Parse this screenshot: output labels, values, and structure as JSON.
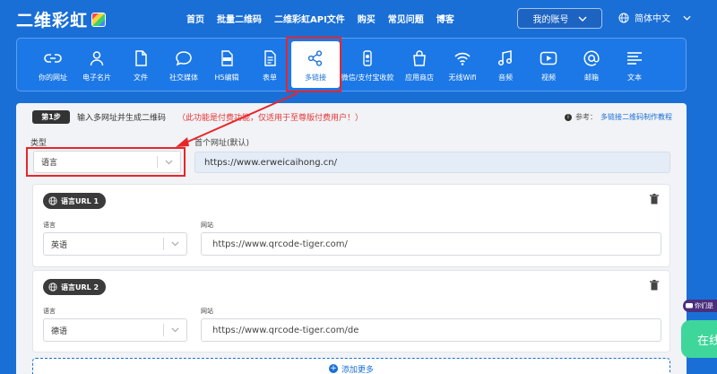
{
  "header": {
    "logo": "二维彩虹",
    "nav": [
      "首页",
      "批量二维码",
      "二维彩虹API文件",
      "购买",
      "常见问题",
      "博客"
    ],
    "account": "我的账号",
    "language": "简体中文"
  },
  "toolbar": {
    "items": [
      {
        "label": "你的网址",
        "icon": "link-icon"
      },
      {
        "label": "电子名片",
        "icon": "person-icon"
      },
      {
        "label": "文件",
        "icon": "file-icon"
      },
      {
        "label": "社交媒体",
        "icon": "chat-bubble-icon"
      },
      {
        "label": "H5编辑",
        "icon": "html-file-icon"
      },
      {
        "label": "表单",
        "icon": "form-icon"
      },
      {
        "label": "多链接",
        "icon": "share-icon"
      },
      {
        "label": "微信/支付宝收款",
        "icon": "wallet-icon"
      },
      {
        "label": "应用商店",
        "icon": "shopping-bag-icon"
      },
      {
        "label": "无线Wifi",
        "icon": "wifi-icon"
      },
      {
        "label": "音频",
        "icon": "music-icon"
      },
      {
        "label": "视频",
        "icon": "video-icon"
      },
      {
        "label": "邮箱",
        "icon": "at-icon"
      },
      {
        "label": "文本",
        "icon": "text-icon"
      }
    ],
    "active_index": 6
  },
  "step": {
    "badge": "第1步",
    "title": "输入多网址并生成二维码",
    "note": "（此功能是付费功能，仅适用于至尊版付费用户！）",
    "ref_label": "参考：",
    "ref_link": "多链接二维码制作教程"
  },
  "form": {
    "type_label": "类型",
    "type_value": "语言",
    "first_url_label": "首个网址(默认)",
    "first_url_value": "https://www.erweicaihong.cn/"
  },
  "cards": [
    {
      "title": "语言URL 1",
      "lang_label": "语言",
      "lang_value": "英语",
      "url_label": "网站",
      "url_value": "https://www.qrcode-tiger.com/"
    },
    {
      "title": "语言URL 2",
      "lang_label": "语言",
      "lang_value": "德语",
      "url_label": "网站",
      "url_value": "https://www.qrcode-tiger.com/de"
    }
  ],
  "add_more": "添加更多",
  "chat": {
    "tip": "你们是",
    "button": "在线"
  },
  "colors": {
    "brand": "#1a6fd6",
    "highlight": "#e8262a",
    "chat": "#3fd69b"
  }
}
